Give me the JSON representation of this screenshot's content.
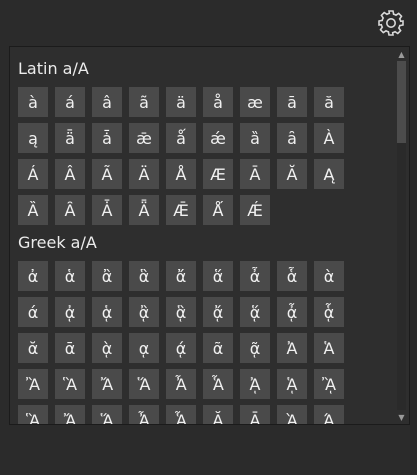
{
  "icons": {
    "settings": "gear-icon",
    "scroll_up": "triangle-up-icon",
    "scroll_down": "triangle-down-icon"
  },
  "colors": {
    "background": "#2b2b2b",
    "cell": "#4a4a4a",
    "text": "#f0f0f0"
  },
  "sections": [
    {
      "title": "Latin a/A",
      "chars": [
        "à",
        "á",
        "â",
        "ã",
        "ä",
        "å",
        "æ",
        "ā",
        "ă",
        "ą",
        "ǟ",
        "ǡ",
        "ǣ",
        "ǻ",
        "ǽ",
        "ȁ",
        "ȃ",
        "À",
        "Á",
        "Â",
        "Ã",
        "Ä",
        "Å",
        "Æ",
        "Ā",
        "Ă",
        "Ą",
        "Ȁ",
        "Ȃ",
        "Ǡ",
        "Ǟ",
        "Ǣ",
        "Ǻ",
        "Ǽ"
      ]
    },
    {
      "title": "Greek a/A",
      "chars": [
        "ἀ",
        "ἁ",
        "ἂ",
        "ἃ",
        "ἄ",
        "ἅ",
        "ἆ",
        "ἇ",
        "ὰ",
        "ά",
        "ᾀ",
        "ᾁ",
        "ᾂ",
        "ᾃ",
        "ᾄ",
        "ᾅ",
        "ᾆ",
        "ᾇ",
        "ᾰ",
        "ᾱ",
        "ᾲ",
        "ᾳ",
        "ᾴ",
        "ᾶ",
        "ᾷ",
        "Ἀ",
        "Ἁ",
        "Ἂ",
        "Ἃ",
        "Ἄ",
        "Ἅ",
        "Ἆ",
        "Ἇ",
        "ᾈ",
        "ᾉ",
        "ᾊ",
        "ᾋ",
        "ᾌ",
        "ᾍ",
        "ᾎ",
        "ᾏ",
        "Ᾰ",
        "Ᾱ",
        "Ὰ",
        "Ά"
      ]
    }
  ]
}
